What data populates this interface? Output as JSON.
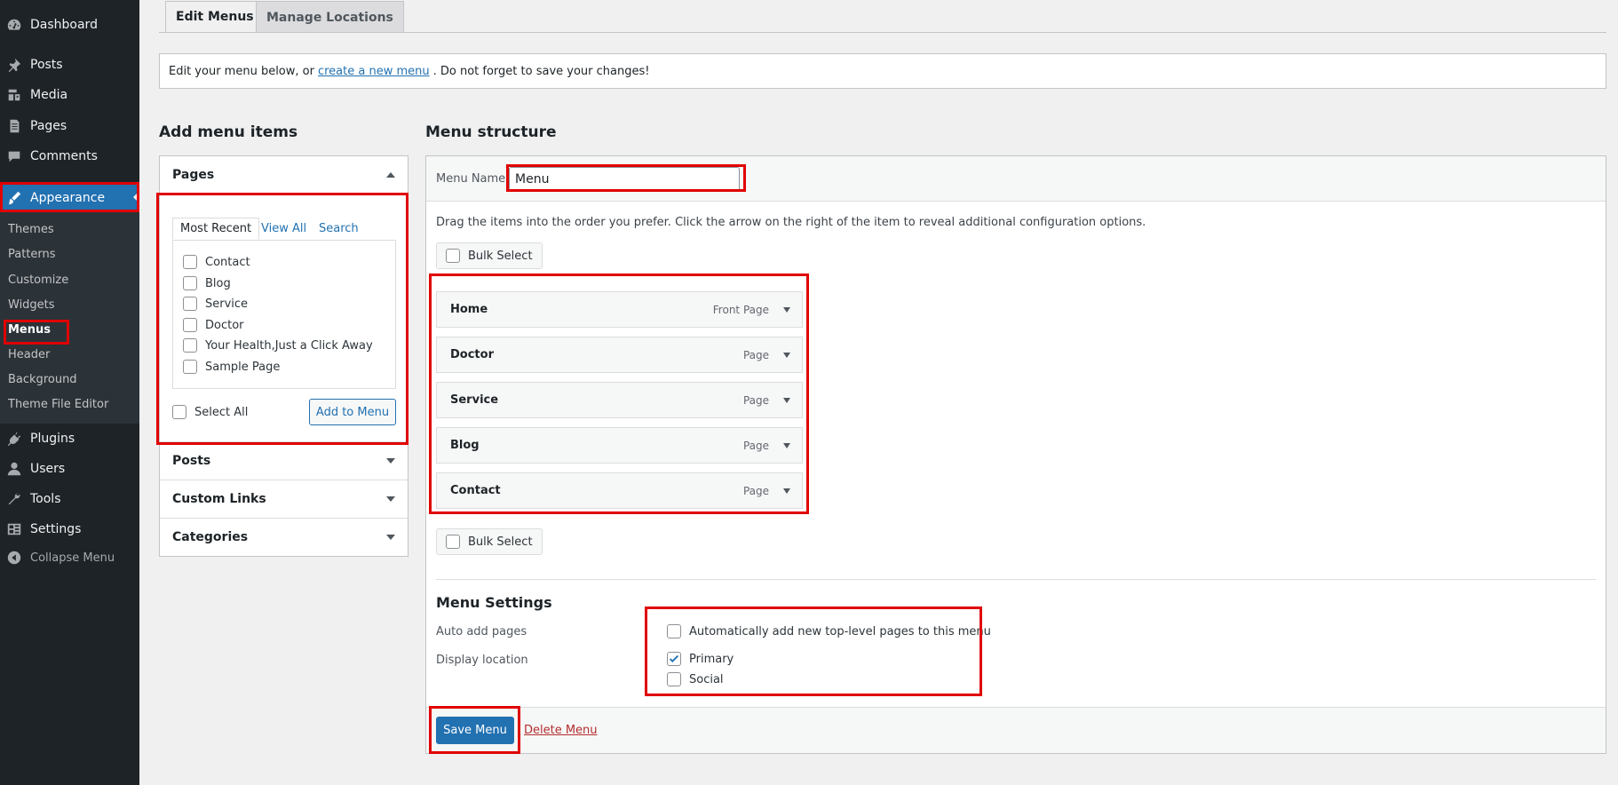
{
  "sidebar": {
    "items": [
      {
        "label": "Dashboard",
        "icon": "dashboard-icon"
      },
      {
        "label": "Posts",
        "icon": "pin-icon"
      },
      {
        "label": "Media",
        "icon": "media-icon"
      },
      {
        "label": "Pages",
        "icon": "pages-icon"
      },
      {
        "label": "Comments",
        "icon": "comment-icon"
      },
      {
        "label": "Appearance",
        "icon": "brush-icon"
      },
      {
        "label": "Plugins",
        "icon": "plugin-icon"
      },
      {
        "label": "Users",
        "icon": "user-icon"
      },
      {
        "label": "Tools",
        "icon": "wrench-icon"
      },
      {
        "label": "Settings",
        "icon": "settings-icon"
      }
    ],
    "submenu": [
      "Themes",
      "Patterns",
      "Customize",
      "Widgets",
      "Menus",
      "Header",
      "Background",
      "Theme File Editor"
    ],
    "collapse_label": "Collapse Menu"
  },
  "tabs": {
    "edit": "Edit Menus",
    "manage": "Manage Locations"
  },
  "notice": {
    "before": "Edit your menu below, or",
    "link": "create a new menu",
    "after": ". Do not forget to save your changes!"
  },
  "add_items": {
    "heading": "Add menu items",
    "pages_section": "Pages",
    "inner_tabs": [
      "Most Recent",
      "View All",
      "Search"
    ],
    "pages": [
      "Contact",
      "Blog",
      "Service",
      "Doctor",
      "Your Health,Just a Click Away",
      "Sample Page"
    ],
    "select_all": "Select All",
    "add_button": "Add to Menu",
    "other_sections": [
      "Posts",
      "Custom Links",
      "Categories"
    ]
  },
  "structure": {
    "heading": "Menu structure",
    "menu_name_label": "Menu Name",
    "menu_name_value": "Menu",
    "instructions": "Drag the items into the order you prefer. Click the arrow on the right of the item to reveal additional configuration options.",
    "bulk_select": "Bulk Select",
    "items": [
      {
        "title": "Home",
        "type": "Front Page"
      },
      {
        "title": "Doctor",
        "type": "Page"
      },
      {
        "title": "Service",
        "type": "Page"
      },
      {
        "title": "Blog",
        "type": "Page"
      },
      {
        "title": "Contact",
        "type": "Page"
      }
    ]
  },
  "settings": {
    "heading": "Menu Settings",
    "auto_add_label": "Auto add pages",
    "auto_add_option": "Automatically add new top-level pages to this menu",
    "display_label": "Display location",
    "locations": [
      {
        "name": "Primary",
        "checked": true
      },
      {
        "name": "Social",
        "checked": false
      }
    ]
  },
  "footer": {
    "save": "Save Menu",
    "delete": "Delete Menu"
  },
  "colors": {
    "accent": "#2271b1",
    "sidebar_bg": "#1d2327",
    "highlight": "#e00000",
    "danger": "#b32d2e"
  }
}
